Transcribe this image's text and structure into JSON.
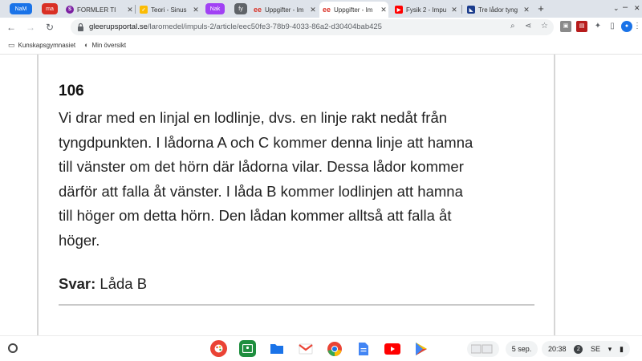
{
  "tabstrip": {
    "groups": [
      {
        "label": "NaM",
        "color": "#1a73e8"
      },
      {
        "label": "ma",
        "color": "#d93025"
      },
      {
        "label": "Nak",
        "color": "#a142f4"
      },
      {
        "label": "fy",
        "color": "#5f6368"
      }
    ],
    "tabs": [
      {
        "title": "FORMLER TI",
        "active": false
      },
      {
        "title": "Teori - Sinus",
        "active": false
      },
      {
        "title": "Uppgifter - Im",
        "active": false
      },
      {
        "title": "Uppgifter - Im",
        "active": true
      },
      {
        "title": "Fysik 2 - Impu",
        "active": false
      },
      {
        "title": "Tre lådor tyng",
        "active": false
      }
    ]
  },
  "toolbar": {
    "url_host": "gleerupsportal.se",
    "url_path": "/laromedel/impuls-2/article/eec50fe3-78b9-4033-86a2-d30404bab425"
  },
  "bookmarks": {
    "items": [
      {
        "label": "Kunskapsgymnasiet"
      },
      {
        "label": "Min översikt"
      }
    ]
  },
  "article": {
    "problem_number": "106",
    "lines": [
      "Vi drar med en linjal en lodlinje, dvs. en linje rakt nedåt från",
      "tyngdpunkten. I lådorna A och C kommer denna linje att hamna",
      "till vänster om det hörn där lådorna vilar. Dessa lådor kommer",
      "därför att falla åt vänster. I låda B kommer lodlinjen att hamna",
      "till höger om detta hörn. Den lådan kommer alltså att falla åt",
      "höger."
    ],
    "answer_label": "Svar:",
    "answer_value": "Låda B"
  },
  "shelf": {
    "date": "5 sep.",
    "time": "20:38",
    "notification_count": "2",
    "locale": "SE"
  }
}
